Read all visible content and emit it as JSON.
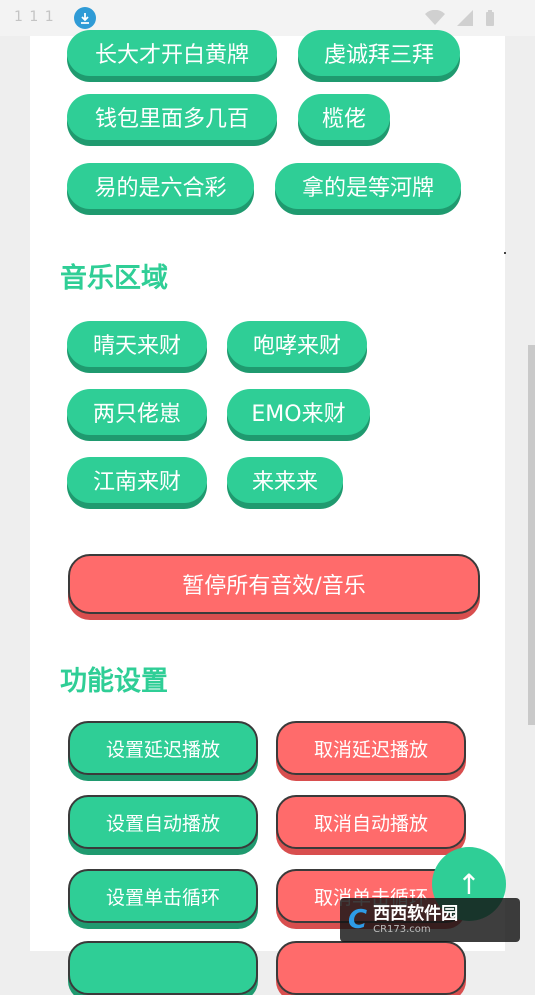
{
  "status_bar": {
    "time": "1 1 1"
  },
  "top_chips": [
    "长大才开白黄牌",
    "虔诚拜三拜",
    "钱包里面多几百",
    "榄佬",
    "易的是六合彩",
    "拿的是等河牌"
  ],
  "music_section": {
    "title": "音乐区域",
    "chips": [
      "晴天来财",
      "咆哮来财",
      "两只佬崽",
      "EMO来财",
      "江南来财",
      "来来来"
    ],
    "stop_button": "暂停所有音效/音乐"
  },
  "settings_section": {
    "title": "功能设置",
    "buttons": [
      {
        "label": "设置延迟播放",
        "variant": "green"
      },
      {
        "label": "取消延迟播放",
        "variant": "red"
      },
      {
        "label": "设置自动播放",
        "variant": "green"
      },
      {
        "label": "取消自动播放",
        "variant": "red"
      },
      {
        "label": "设置单击循环",
        "variant": "green"
      },
      {
        "label": "取消单击循环",
        "variant": "red"
      }
    ]
  },
  "fab": {
    "icon": "arrow-up-icon",
    "glyph": "↑"
  },
  "watermark": {
    "logo": "C",
    "main": "西西软件园",
    "sub": "CR173.com"
  },
  "colors": {
    "accent_green": "#2fce96",
    "accent_red": "#ff6b6b"
  }
}
